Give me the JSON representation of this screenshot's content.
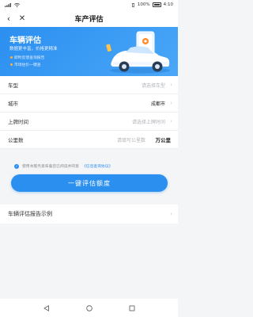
{
  "status_bar": {
    "battery_percent": "100%",
    "time": "4:10"
  },
  "navbar": {
    "title": "车产评估"
  },
  "banner": {
    "title": "车辆评估",
    "subtitle": "数据更丰富，价格更精准",
    "points": [
      "即时反馈查询报告",
      "市场估价一键查"
    ]
  },
  "form": {
    "rows": [
      {
        "label": "车型",
        "value": "请选择车型",
        "filled": false
      },
      {
        "label": "城市",
        "value": "成都市",
        "filled": true
      },
      {
        "label": "上牌时间",
        "value": "请选择上牌时间",
        "filled": false
      },
      {
        "label": "公里数",
        "value": "请填写公里数",
        "unit": "万公里",
        "filled": false
      }
    ]
  },
  "agreement": {
    "text": "使用本服务意味着您已阅读并同意",
    "link": "《信息查询协议》"
  },
  "primary_button": {
    "label": "一键评估额度"
  },
  "example": {
    "label": "车辆评估报告示例"
  },
  "colors": {
    "accent": "#2b8ff0",
    "background": "#f4f5f7"
  }
}
